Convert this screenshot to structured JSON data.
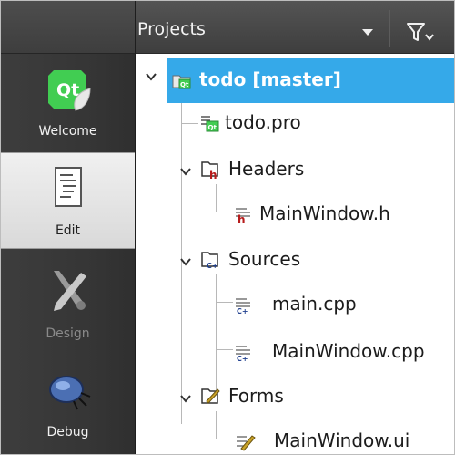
{
  "modes": [
    {
      "label": "Welcome",
      "icon": "qt-logo-icon",
      "state": "normal"
    },
    {
      "label": "Edit",
      "icon": "edit-document-icon",
      "state": "active"
    },
    {
      "label": "Design",
      "icon": "design-tools-icon",
      "state": "disabled"
    },
    {
      "label": "Debug",
      "icon": "debug-bug-icon",
      "state": "normal"
    }
  ],
  "panel": {
    "title": "Projects",
    "filter_icon": "filter-icon"
  },
  "tree": {
    "project": {
      "label": "todo [master]",
      "icon": "qt-project-icon"
    },
    "items": [
      {
        "label": "todo.pro",
        "icon": "qt-pro-file-icon"
      },
      {
        "label": "Headers",
        "icon": "headers-folder-icon"
      },
      {
        "label": "MainWindow.h",
        "icon": "header-file-icon"
      },
      {
        "label": "Sources",
        "icon": "sources-folder-icon"
      },
      {
        "label": "main.cpp",
        "icon": "cpp-file-icon"
      },
      {
        "label": "MainWindow.cpp",
        "icon": "cpp-file-icon"
      },
      {
        "label": "Forms",
        "icon": "forms-folder-icon"
      },
      {
        "label": "MainWindow.ui",
        "icon": "ui-form-file-icon"
      }
    ]
  },
  "colors": {
    "selection": "#35a9e9",
    "modebar": "#3a3a3a",
    "header_red": "#b71c1c"
  }
}
